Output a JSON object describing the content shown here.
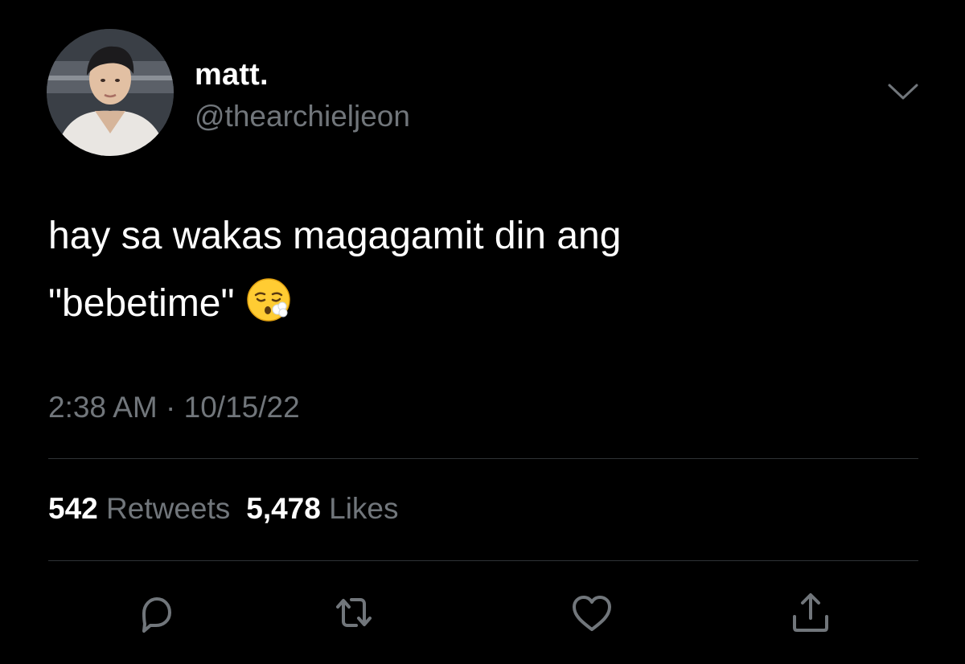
{
  "user": {
    "display_name": "matt.",
    "handle": "@thearchieljeon"
  },
  "tweet": {
    "text_line_1": "hay sa wakas magagamit din ang",
    "text_line_2": "\"bebetime\"",
    "emoji": "face-exhaling-emoji",
    "timestamp": "2:38 AM · 10/15/22"
  },
  "stats": {
    "retweets_count": "542",
    "retweets_label": "Retweets",
    "likes_count": "5,478",
    "likes_label": "Likes"
  },
  "actions": {
    "reply_icon": "reply-icon",
    "retweet_icon": "retweet-icon",
    "like_icon": "heart-icon",
    "share_icon": "share-icon"
  },
  "colors": {
    "background": "#000000",
    "primary_text": "#ffffff",
    "secondary_text": "#71767b",
    "divider": "#2f3336",
    "icon": "#71767b"
  }
}
